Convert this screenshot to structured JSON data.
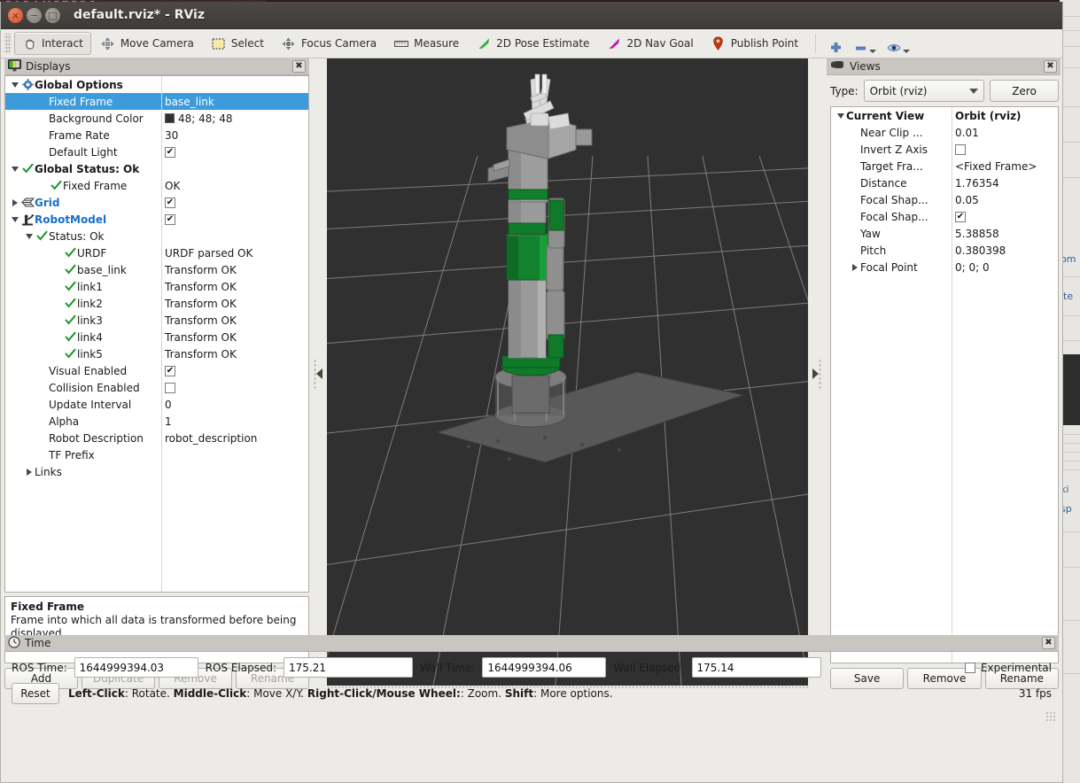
{
  "background": {
    "top_window_text": "PARAMETERS",
    "right_strip_texts": [
      "om",
      "ite",
      "ki",
      "sp"
    ]
  },
  "window": {
    "title": "default.rviz* - RViz",
    "close_glyph": "×",
    "minimize_glyph": "−",
    "maximize_glyph": "□"
  },
  "toolbar": {
    "buttons": [
      {
        "label": "Interact",
        "icon": "hand-cursor-icon",
        "active": true
      },
      {
        "label": "Move Camera",
        "icon": "move-camera-icon",
        "active": false
      },
      {
        "label": "Select",
        "icon": "select-rectangle-icon",
        "active": false
      },
      {
        "label": "Focus Camera",
        "icon": "focus-camera-icon",
        "active": false
      },
      {
        "label": "Measure",
        "icon": "ruler-icon",
        "active": false
      },
      {
        "label": "2D Pose Estimate",
        "icon": "green-arrow-icon",
        "active": false
      },
      {
        "label": "2D Nav Goal",
        "icon": "magenta-arrow-icon",
        "active": false
      },
      {
        "label": "Publish Point",
        "icon": "map-pin-icon",
        "active": false
      }
    ],
    "zoom_buttons": [
      {
        "icon": "plus-icon",
        "name": "zoom-in-button"
      },
      {
        "icon": "minus-icon",
        "name": "zoom-out-button"
      },
      {
        "icon": "eye-icon",
        "name": "view-button"
      }
    ]
  },
  "displays": {
    "panel_title": "Displays",
    "panel_icon": "displays-monitor-icon",
    "close_glyph": "✖",
    "rows": [
      {
        "indent": 0,
        "twist": "open",
        "icon": "gear-icon",
        "label": "Global Options",
        "style": "bold",
        "value": "",
        "vtype": "none"
      },
      {
        "indent": 2,
        "twist": "none",
        "icon": "none",
        "label": "Fixed Frame",
        "style": "sel",
        "value": "base_link",
        "vtype": "text"
      },
      {
        "indent": 2,
        "twist": "none",
        "icon": "none",
        "label": "Background Color",
        "style": "",
        "value": "48; 48; 48",
        "vtype": "color"
      },
      {
        "indent": 2,
        "twist": "none",
        "icon": "none",
        "label": "Frame Rate",
        "style": "",
        "value": "30",
        "vtype": "text"
      },
      {
        "indent": 2,
        "twist": "none",
        "icon": "none",
        "label": "Default Light",
        "style": "",
        "value": "checked",
        "vtype": "check"
      },
      {
        "indent": 0,
        "twist": "open",
        "icon": "check-icon",
        "label": "Global Status: Ok",
        "style": "bold",
        "value": "",
        "vtype": "none"
      },
      {
        "indent": 2,
        "twist": "none",
        "icon": "check-icon",
        "label": "Fixed Frame",
        "style": "",
        "value": "OK",
        "vtype": "text"
      },
      {
        "indent": 0,
        "twist": "closed",
        "icon": "grid-icon",
        "label": "Grid",
        "style": "blue",
        "value": "checked",
        "vtype": "check"
      },
      {
        "indent": 0,
        "twist": "open",
        "icon": "robot-icon",
        "label": "RobotModel",
        "style": "blue",
        "value": "checked",
        "vtype": "check"
      },
      {
        "indent": 1,
        "twist": "open",
        "icon": "check-icon",
        "label": "Status: Ok",
        "style": "",
        "value": "",
        "vtype": "none"
      },
      {
        "indent": 3,
        "twist": "none",
        "icon": "check-icon",
        "label": "URDF",
        "style": "",
        "value": "URDF parsed OK",
        "vtype": "text"
      },
      {
        "indent": 3,
        "twist": "none",
        "icon": "check-icon",
        "label": "base_link",
        "style": "",
        "value": "Transform OK",
        "vtype": "text"
      },
      {
        "indent": 3,
        "twist": "none",
        "icon": "check-icon",
        "label": "link1",
        "style": "",
        "value": "Transform OK",
        "vtype": "text"
      },
      {
        "indent": 3,
        "twist": "none",
        "icon": "check-icon",
        "label": "link2",
        "style": "",
        "value": "Transform OK",
        "vtype": "text"
      },
      {
        "indent": 3,
        "twist": "none",
        "icon": "check-icon",
        "label": "link3",
        "style": "",
        "value": "Transform OK",
        "vtype": "text"
      },
      {
        "indent": 3,
        "twist": "none",
        "icon": "check-icon",
        "label": "link4",
        "style": "",
        "value": "Transform OK",
        "vtype": "text"
      },
      {
        "indent": 3,
        "twist": "none",
        "icon": "check-icon",
        "label": "link5",
        "style": "",
        "value": "Transform OK",
        "vtype": "text"
      },
      {
        "indent": 2,
        "twist": "none",
        "icon": "none",
        "label": "Visual Enabled",
        "style": "",
        "value": "checked",
        "vtype": "check"
      },
      {
        "indent": 2,
        "twist": "none",
        "icon": "none",
        "label": "Collision Enabled",
        "style": "",
        "value": "unchecked",
        "vtype": "check"
      },
      {
        "indent": 2,
        "twist": "none",
        "icon": "none",
        "label": "Update Interval",
        "style": "",
        "value": "0",
        "vtype": "text"
      },
      {
        "indent": 2,
        "twist": "none",
        "icon": "none",
        "label": "Alpha",
        "style": "",
        "value": "1",
        "vtype": "text"
      },
      {
        "indent": 2,
        "twist": "none",
        "icon": "none",
        "label": "Robot Description",
        "style": "",
        "value": "robot_description",
        "vtype": "text"
      },
      {
        "indent": 2,
        "twist": "none",
        "icon": "none",
        "label": "TF Prefix",
        "style": "",
        "value": "",
        "vtype": "text"
      },
      {
        "indent": 1,
        "twist": "closed",
        "icon": "none",
        "label": "Links",
        "style": "",
        "value": "",
        "vtype": "none"
      }
    ],
    "description": {
      "title": "Fixed Frame",
      "text": "Frame into which all data is transformed before being displayed."
    },
    "buttons": [
      {
        "label": "Add",
        "enabled": true
      },
      {
        "label": "Duplicate",
        "enabled": false
      },
      {
        "label": "Remove",
        "enabled": false
      },
      {
        "label": "Rename",
        "enabled": false
      }
    ]
  },
  "views": {
    "panel_title": "Views",
    "panel_icon": "camera-view-icon",
    "close_glyph": "✖",
    "type_label": "Type:",
    "type_value": "Orbit (rviz)",
    "zero_button": "Zero",
    "rows": [
      {
        "indent": 0,
        "twist": "open",
        "label": "Current View",
        "style": "bold",
        "value": "Orbit (rviz)",
        "vtype": "text",
        "vstyle": "bold"
      },
      {
        "indent": 1,
        "twist": "none",
        "label": "Near Clip ...",
        "style": "",
        "value": "0.01",
        "vtype": "text",
        "vstyle": ""
      },
      {
        "indent": 1,
        "twist": "none",
        "label": "Invert Z Axis",
        "style": "",
        "value": "unchecked",
        "vtype": "check",
        "vstyle": ""
      },
      {
        "indent": 1,
        "twist": "none",
        "label": "Target Fra...",
        "style": "",
        "value": "<Fixed Frame>",
        "vtype": "text",
        "vstyle": ""
      },
      {
        "indent": 1,
        "twist": "none",
        "label": "Distance",
        "style": "",
        "value": "1.76354",
        "vtype": "text",
        "vstyle": ""
      },
      {
        "indent": 1,
        "twist": "none",
        "label": "Focal Shap...",
        "style": "",
        "value": "0.05",
        "vtype": "text",
        "vstyle": ""
      },
      {
        "indent": 1,
        "twist": "none",
        "label": "Focal Shap...",
        "style": "",
        "value": "checked",
        "vtype": "check",
        "vstyle": ""
      },
      {
        "indent": 1,
        "twist": "none",
        "label": "Yaw",
        "style": "",
        "value": "5.38858",
        "vtype": "text",
        "vstyle": ""
      },
      {
        "indent": 1,
        "twist": "none",
        "label": "Pitch",
        "style": "",
        "value": "0.380398",
        "vtype": "text",
        "vstyle": ""
      },
      {
        "indent": 1,
        "twist": "closed",
        "label": "Focal Point",
        "style": "",
        "value": "0; 0; 0",
        "vtype": "text",
        "vstyle": ""
      }
    ],
    "buttons": [
      "Save",
      "Remove",
      "Rename"
    ]
  },
  "time": {
    "panel_title": "Time",
    "panel_icon": "clock-icon",
    "close_glyph": "✖",
    "fields": [
      {
        "label": "ROS Time:",
        "value": "1644999394.03"
      },
      {
        "label": "ROS Elapsed:",
        "value": "175.21"
      },
      {
        "label": "Wall Time:",
        "value": "1644999394.06"
      },
      {
        "label": "Wall Elapsed:",
        "value": "175.14"
      }
    ],
    "experimental_label": "Experimental",
    "experimental_checked": false,
    "reset_button": "Reset",
    "hint_segments": [
      {
        "text": "Left-Click",
        "bold": true
      },
      {
        "text": ": Rotate. ",
        "bold": false
      },
      {
        "text": "Middle-Click",
        "bold": true
      },
      {
        "text": ": Move X/Y. ",
        "bold": false
      },
      {
        "text": "Right-Click/Mouse Wheel:",
        "bold": true
      },
      {
        "text": ": Zoom. ",
        "bold": false
      },
      {
        "text": "Shift",
        "bold": true
      },
      {
        "text": ": More options.",
        "bold": false
      }
    ],
    "fps": "31 fps"
  },
  "viewport": {
    "background_color": "#303030",
    "grid_color": "#8b8b8b",
    "robot_metal_color": "#9a9a9a",
    "robot_green_color": "#0f7a2a",
    "gripper_color": "#d8d8d8"
  }
}
